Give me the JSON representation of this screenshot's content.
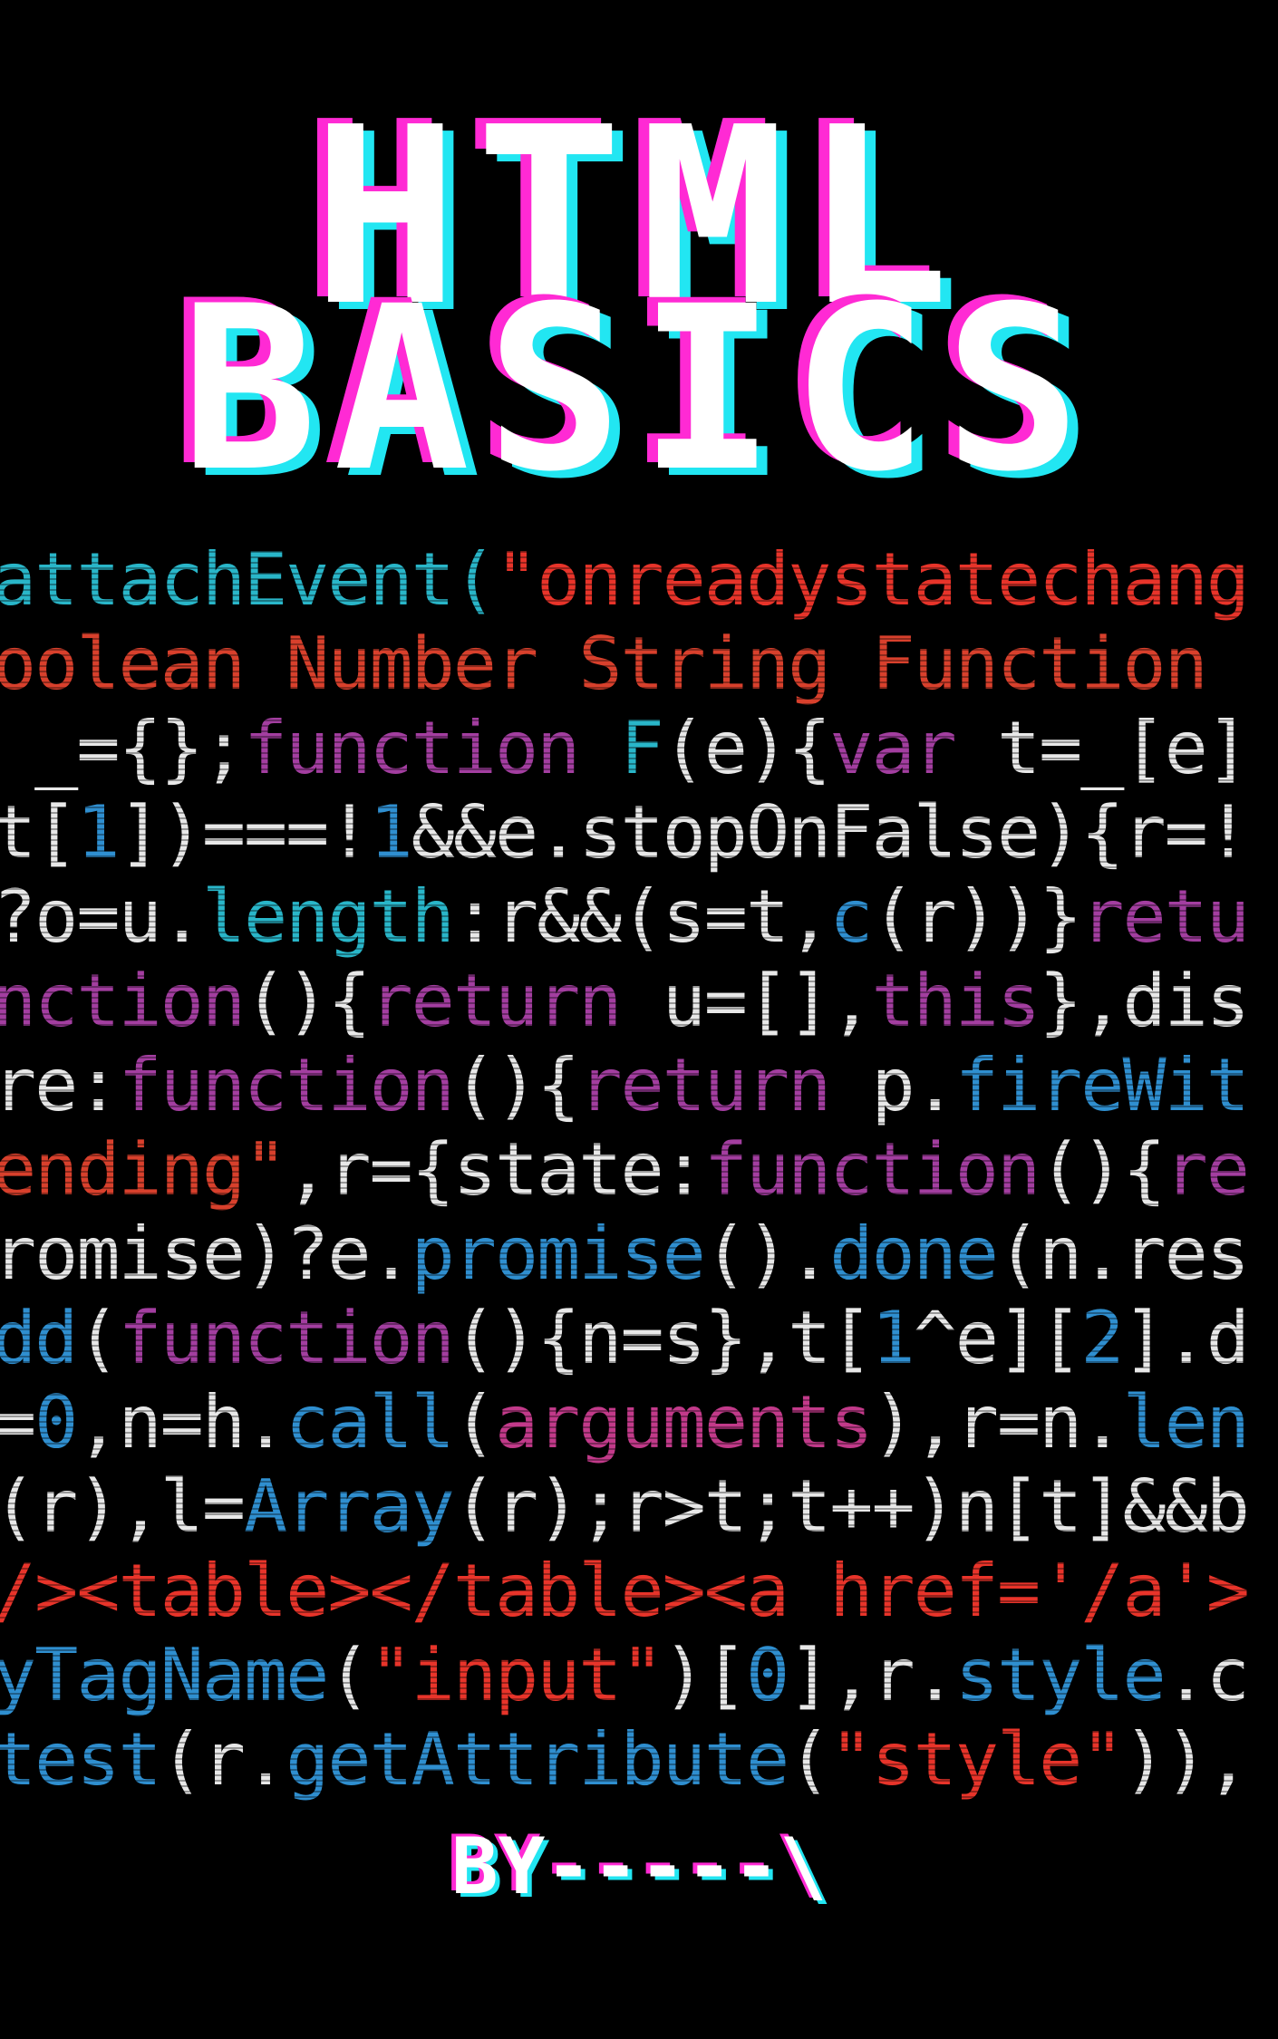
{
  "title": {
    "line1": "HTML",
    "line2": "BASICS"
  },
  "colors": {
    "background": "#000000",
    "title_text": "#ffffff",
    "title_shadow_magenta": "#ff2ad4",
    "title_shadow_cyan": "#22e6f2",
    "code_white": "#e8e8e8",
    "code_cyan": "#29b6c9",
    "code_red": "#e8342a",
    "code_orange_red": "#d8402c",
    "code_purple": "#a33ea0",
    "code_blue": "#2f8fd0",
    "code_magenta": "#c23a8a"
  },
  "code_lines": [
    {
      "segments": [
        {
          "text": "attachEvent(",
          "color": "#29b6c9"
        },
        {
          "text": "\"onreadystatechang",
          "color": "#e8342a"
        }
      ]
    },
    {
      "segments": [
        {
          "text": "oolean Number String Function ",
          "color": "#d8402c"
        }
      ]
    },
    {
      "segments": [
        {
          "text": " _={};",
          "color": "#e8e8e8"
        },
        {
          "text": "function ",
          "color": "#a33ea0"
        },
        {
          "text": "F",
          "color": "#29b6c9"
        },
        {
          "text": "(e){",
          "color": "#e8e8e8"
        },
        {
          "text": "var ",
          "color": "#a33ea0"
        },
        {
          "text": "t=_[e]",
          "color": "#e8e8e8"
        }
      ]
    },
    {
      "segments": [
        {
          "text": "t[",
          "color": "#e8e8e8"
        },
        {
          "text": "1",
          "color": "#2f8fd0"
        },
        {
          "text": "])===!",
          "color": "#e8e8e8"
        },
        {
          "text": "1",
          "color": "#2f8fd0"
        },
        {
          "text": "&&e.stopOnFalse){r=!",
          "color": "#e8e8e8"
        }
      ]
    },
    {
      "segments": [
        {
          "text": "?o=u.",
          "color": "#e8e8e8"
        },
        {
          "text": "length",
          "color": "#29b6c9"
        },
        {
          "text": ":r&&(s=t,",
          "color": "#e8e8e8"
        },
        {
          "text": "c",
          "color": "#2f8fd0"
        },
        {
          "text": "(r))}",
          "color": "#e8e8e8"
        },
        {
          "text": "retu",
          "color": "#a33ea0"
        }
      ]
    },
    {
      "segments": [
        {
          "text": "nction",
          "color": "#a33ea0"
        },
        {
          "text": "(){",
          "color": "#e8e8e8"
        },
        {
          "text": "return ",
          "color": "#a33ea0"
        },
        {
          "text": "u=[],",
          "color": "#e8e8e8"
        },
        {
          "text": "this",
          "color": "#a33ea0"
        },
        {
          "text": "},dis",
          "color": "#e8e8e8"
        }
      ]
    },
    {
      "segments": [
        {
          "text": "re:",
          "color": "#e8e8e8"
        },
        {
          "text": "function",
          "color": "#a33ea0"
        },
        {
          "text": "(){",
          "color": "#e8e8e8"
        },
        {
          "text": "return ",
          "color": "#a33ea0"
        },
        {
          "text": "p.",
          "color": "#e8e8e8"
        },
        {
          "text": "fireWit",
          "color": "#2f8fd0"
        }
      ]
    },
    {
      "segments": [
        {
          "text": "ending\"",
          "color": "#d8402c"
        },
        {
          "text": ",r={state:",
          "color": "#e8e8e8"
        },
        {
          "text": "function",
          "color": "#a33ea0"
        },
        {
          "text": "(){",
          "color": "#e8e8e8"
        },
        {
          "text": "re",
          "color": "#a33ea0"
        }
      ]
    },
    {
      "segments": [
        {
          "text": "romise)?e.",
          "color": "#e8e8e8"
        },
        {
          "text": "promise",
          "color": "#2f8fd0"
        },
        {
          "text": "().",
          "color": "#e8e8e8"
        },
        {
          "text": "done",
          "color": "#2f8fd0"
        },
        {
          "text": "(n.res",
          "color": "#e8e8e8"
        }
      ]
    },
    {
      "segments": [
        {
          "text": "dd",
          "color": "#2f8fd0"
        },
        {
          "text": "(",
          "color": "#e8e8e8"
        },
        {
          "text": "function",
          "color": "#a33ea0"
        },
        {
          "text": "(){n=s},t[",
          "color": "#e8e8e8"
        },
        {
          "text": "1",
          "color": "#2f8fd0"
        },
        {
          "text": "^e][",
          "color": "#e8e8e8"
        },
        {
          "text": "2",
          "color": "#2f8fd0"
        },
        {
          "text": "].d",
          "color": "#e8e8e8"
        }
      ]
    },
    {
      "segments": [
        {
          "text": "=",
          "color": "#e8e8e8"
        },
        {
          "text": "0",
          "color": "#2f8fd0"
        },
        {
          "text": ",n=h.",
          "color": "#e8e8e8"
        },
        {
          "text": "call",
          "color": "#2f8fd0"
        },
        {
          "text": "(",
          "color": "#e8e8e8"
        },
        {
          "text": "arguments",
          "color": "#c23a8a"
        },
        {
          "text": "),r=n.",
          "color": "#e8e8e8"
        },
        {
          "text": "len",
          "color": "#2f8fd0"
        }
      ]
    },
    {
      "segments": [
        {
          "text": "(r),l=",
          "color": "#e8e8e8"
        },
        {
          "text": "Array",
          "color": "#2f8fd0"
        },
        {
          "text": "(r);r>t;t++)n[t]&&b",
          "color": "#e8e8e8"
        }
      ]
    },
    {
      "segments": [
        {
          "text": "/><table></table><a href='/a'>",
          "color": "#e8342a"
        }
      ]
    },
    {
      "segments": [
        {
          "text": "yTagName",
          "color": "#2f8fd0"
        },
        {
          "text": "(",
          "color": "#e8e8e8"
        },
        {
          "text": "\"input\"",
          "color": "#e8342a"
        },
        {
          "text": ")[",
          "color": "#e8e8e8"
        },
        {
          "text": "0",
          "color": "#2f8fd0"
        },
        {
          "text": "],r.",
          "color": "#e8e8e8"
        },
        {
          "text": "style",
          "color": "#2f8fd0"
        },
        {
          "text": ".c",
          "color": "#e8e8e8"
        }
      ]
    },
    {
      "segments": [
        {
          "text": "test",
          "color": "#2f8fd0"
        },
        {
          "text": "(r.",
          "color": "#e8e8e8"
        },
        {
          "text": "getAttribute",
          "color": "#2f8fd0"
        },
        {
          "text": "(",
          "color": "#e8e8e8"
        },
        {
          "text": "\"style\"",
          "color": "#e8342a"
        },
        {
          "text": ")),",
          "color": "#e8e8e8"
        }
      ]
    }
  ],
  "byline": "BY-----\\"
}
